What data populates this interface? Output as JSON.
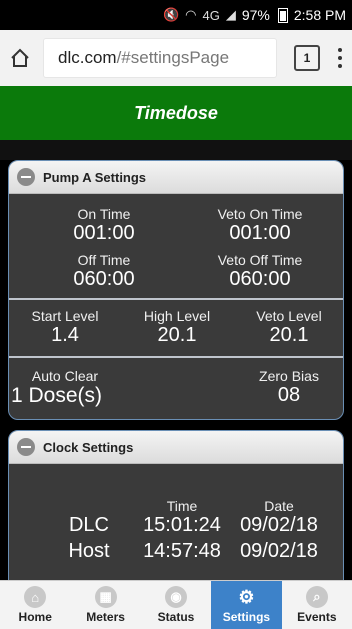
{
  "status_bar": {
    "battery": "97%",
    "time": "2:58 PM",
    "network": "4G"
  },
  "browser": {
    "url_domain": "dlc.com",
    "url_path": "/#settingsPage",
    "tab_count": "1"
  },
  "header": {
    "title": "Timedose"
  },
  "pump_panel": {
    "title": "Pump A Settings",
    "on_time_label": "On Time",
    "on_time": "001:00",
    "veto_on_time_label": "Veto On Time",
    "veto_on_time": "001:00",
    "off_time_label": "Off Time",
    "off_time": "060:00",
    "veto_off_time_label": "Veto Off Time",
    "veto_off_time": "060:00",
    "start_level_label": "Start Level",
    "start_level": "1.4",
    "high_level_label": "High Level",
    "high_level": "20.1",
    "veto_level_label": "Veto Level",
    "veto_level": "20.1",
    "auto_clear_label": "Auto Clear",
    "auto_clear": "1 Dose(s)",
    "zero_bias_label": "Zero Bias",
    "zero_bias": "08"
  },
  "clock_panel": {
    "title": "Clock Settings",
    "time_header": "Time",
    "date_header": "Date",
    "rows": [
      {
        "name": "DLC",
        "time": "15:01:24",
        "date": "09/02/18"
      },
      {
        "name": "Host",
        "time": "14:57:48",
        "date": "09/02/18"
      }
    ]
  },
  "nav": {
    "items": [
      {
        "label": "Home",
        "icon": "home-icon"
      },
      {
        "label": "Meters",
        "icon": "meters-icon"
      },
      {
        "label": "Status",
        "icon": "status-icon"
      },
      {
        "label": "Settings",
        "icon": "gear-icon",
        "active": true
      },
      {
        "label": "Events",
        "icon": "search-icon"
      }
    ]
  },
  "colors": {
    "header_green": "#0b7a0b",
    "active_blue": "#3d82c9",
    "panel_bg": "#3a3a3a"
  }
}
